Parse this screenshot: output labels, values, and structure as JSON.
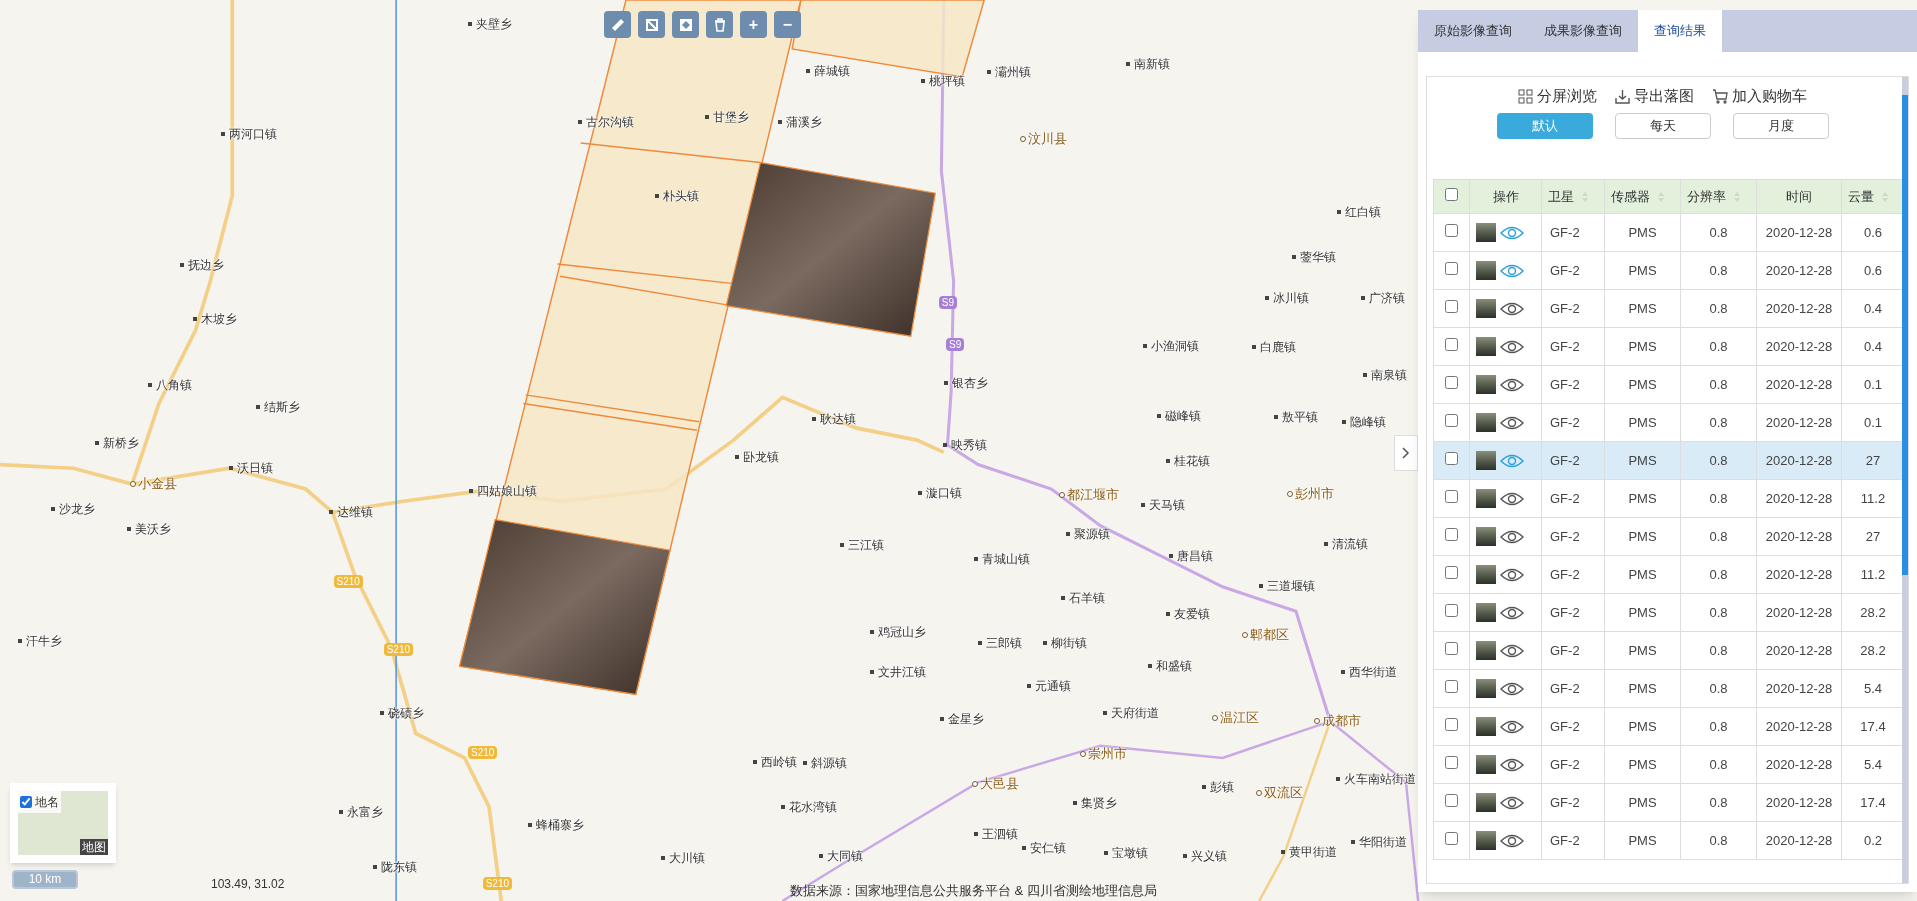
{
  "map_toolbar": [
    {
      "kind": "ruler"
    },
    {
      "kind": "polygon"
    },
    {
      "kind": "frame"
    },
    {
      "kind": "trash"
    },
    {
      "kind": "text",
      "label": "+"
    },
    {
      "kind": "text",
      "label": "−"
    }
  ],
  "map": {
    "places": [
      {
        "name": "夹壁乡",
        "kind": "town"
      },
      {
        "name": "两河口镇",
        "kind": "town"
      },
      {
        "name": "抚边乡",
        "kind": "town"
      },
      {
        "name": "木坡乡",
        "kind": "town"
      },
      {
        "name": "八角镇",
        "kind": "town"
      },
      {
        "name": "结斯乡",
        "kind": "town"
      },
      {
        "name": "新桥乡",
        "kind": "town"
      },
      {
        "name": "沃日镇",
        "kind": "town"
      },
      {
        "name": "小金县",
        "kind": "county"
      },
      {
        "name": "沙龙乡",
        "kind": "town"
      },
      {
        "name": "美沃乡",
        "kind": "town"
      },
      {
        "name": "达维镇",
        "kind": "town"
      },
      {
        "name": "汗牛乡",
        "kind": "town"
      },
      {
        "name": "四姑娘山镇",
        "kind": "town"
      },
      {
        "name": "硗碛乡",
        "kind": "town"
      },
      {
        "name": "永富乡",
        "kind": "town"
      },
      {
        "name": "陇东镇",
        "kind": "town"
      },
      {
        "name": "蜂桶寨乡",
        "kind": "town"
      },
      {
        "name": "大川镇",
        "kind": "town"
      },
      {
        "name": "古尔沟镇",
        "kind": "town"
      },
      {
        "name": "甘堡乡",
        "kind": "town"
      },
      {
        "name": "朴头镇",
        "kind": "town"
      },
      {
        "name": "蒲溪乡",
        "kind": "town"
      },
      {
        "name": "薛城镇",
        "kind": "town"
      },
      {
        "name": "桃坪镇",
        "kind": "town"
      },
      {
        "name": "灞州镇",
        "kind": "town"
      },
      {
        "name": "南新镇",
        "kind": "town"
      },
      {
        "name": "汶川县",
        "kind": "county"
      },
      {
        "name": "红白镇",
        "kind": "town"
      },
      {
        "name": "蓥华镇",
        "kind": "town"
      },
      {
        "name": "冰川镇",
        "kind": "town"
      },
      {
        "name": "广济镇",
        "kind": "town"
      },
      {
        "name": "小渔洞镇",
        "kind": "town"
      },
      {
        "name": "白鹿镇",
        "kind": "town"
      },
      {
        "name": "南泉镇",
        "kind": "town"
      },
      {
        "name": "银杏乡",
        "kind": "town"
      },
      {
        "name": "耿达镇",
        "kind": "town"
      },
      {
        "name": "磁峰镇",
        "kind": "town"
      },
      {
        "name": "敖平镇",
        "kind": "town"
      },
      {
        "name": "隐峰镇",
        "kind": "town"
      },
      {
        "name": "卧龙镇",
        "kind": "town"
      },
      {
        "name": "映秀镇",
        "kind": "town"
      },
      {
        "name": "桂花镇",
        "kind": "town"
      },
      {
        "name": "漩口镇",
        "kind": "town"
      },
      {
        "name": "都江堰市",
        "kind": "county"
      },
      {
        "name": "天马镇",
        "kind": "town"
      },
      {
        "name": "彭州市",
        "kind": "county"
      },
      {
        "name": "聚源镇",
        "kind": "town"
      },
      {
        "name": "三江镇",
        "kind": "town"
      },
      {
        "name": "青城山镇",
        "kind": "town"
      },
      {
        "name": "唐昌镇",
        "kind": "town"
      },
      {
        "name": "清流镇",
        "kind": "town"
      },
      {
        "name": "石羊镇",
        "kind": "town"
      },
      {
        "name": "三道堰镇",
        "kind": "town"
      },
      {
        "name": "友爱镇",
        "kind": "town"
      },
      {
        "name": "鸡冠山乡",
        "kind": "town"
      },
      {
        "name": "郫都区",
        "kind": "county"
      },
      {
        "name": "三郎镇",
        "kind": "town"
      },
      {
        "name": "柳街镇",
        "kind": "town"
      },
      {
        "name": "和盛镇",
        "kind": "town"
      },
      {
        "name": "文井江镇",
        "kind": "town"
      },
      {
        "name": "元通镇",
        "kind": "town"
      },
      {
        "name": "西华街道",
        "kind": "town"
      },
      {
        "name": "金星乡",
        "kind": "town"
      },
      {
        "name": "天府街道",
        "kind": "town"
      },
      {
        "name": "温江区",
        "kind": "county"
      },
      {
        "name": "成都市",
        "kind": "county"
      },
      {
        "name": "西岭镇",
        "kind": "town"
      },
      {
        "name": "斜源镇",
        "kind": "town"
      },
      {
        "name": "崇州市",
        "kind": "county"
      },
      {
        "name": "大邑县",
        "kind": "county"
      },
      {
        "name": "集贤乡",
        "kind": "town"
      },
      {
        "name": "彭镇",
        "kind": "town"
      },
      {
        "name": "双流区",
        "kind": "county"
      },
      {
        "name": "火车南站街道",
        "kind": "town"
      },
      {
        "name": "花水湾镇",
        "kind": "town"
      },
      {
        "name": "王泗镇",
        "kind": "town"
      },
      {
        "name": "安仁镇",
        "kind": "town"
      },
      {
        "name": "宝墩镇",
        "kind": "town"
      },
      {
        "name": "兴义镇",
        "kind": "town"
      },
      {
        "name": "黄甲街道",
        "kind": "town"
      },
      {
        "name": "华阳街道",
        "kind": "town"
      },
      {
        "name": "大同镇",
        "kind": "town"
      }
    ],
    "road_labels": [
      {
        "label": "S9",
        "kind": "expressway"
      },
      {
        "label": "S9",
        "kind": "expressway"
      },
      {
        "label": "S210",
        "kind": "provincial"
      },
      {
        "label": "S210",
        "kind": "provincial"
      },
      {
        "label": "S210",
        "kind": "provincial"
      },
      {
        "label": "S210",
        "kind": "provincial"
      }
    ]
  },
  "layer_switcher": {
    "label": "地名",
    "checked": true,
    "thumbnail_label": "地图"
  },
  "scale": "10 km",
  "coordinates": "103.49, 31.02",
  "attribution": "数据来源：国家地理信息公共服务平台 & 四川省测绘地理信息局",
  "panel": {
    "tabs": [
      {
        "label": "原始影像查询",
        "selected": false
      },
      {
        "label": "成果影像查询",
        "selected": false
      },
      {
        "label": "查询结果",
        "selected": true
      }
    ],
    "actions": [
      {
        "kind": "grid",
        "label": "分屏浏览"
      },
      {
        "kind": "download",
        "label": "导出落图"
      },
      {
        "kind": "cart",
        "label": "加入购物车"
      }
    ],
    "period_buttons": [
      {
        "label": "默认",
        "selected": true
      },
      {
        "label": "每天",
        "selected": false
      },
      {
        "label": "月度",
        "selected": false
      }
    ],
    "table": {
      "header_checked": false,
      "action_column_label": "操作",
      "columns": [
        {
          "label": "卫星",
          "sortable": true
        },
        {
          "label": "传感器",
          "sortable": true
        },
        {
          "label": "分辨率",
          "sortable": true
        },
        {
          "label": "时间",
          "sortable": false
        },
        {
          "label": "云量",
          "sortable": true
        }
      ],
      "rows": [
        {
          "checked": false,
          "previewed": true,
          "selected": false,
          "cells": [
            "GF-2",
            "PMS",
            "0.8",
            "2020-12-28",
            "0.6"
          ]
        },
        {
          "checked": false,
          "previewed": true,
          "selected": false,
          "cells": [
            "GF-2",
            "PMS",
            "0.8",
            "2020-12-28",
            "0.6"
          ]
        },
        {
          "checked": false,
          "previewed": false,
          "selected": false,
          "cells": [
            "GF-2",
            "PMS",
            "0.8",
            "2020-12-28",
            "0.4"
          ]
        },
        {
          "checked": false,
          "previewed": false,
          "selected": false,
          "cells": [
            "GF-2",
            "PMS",
            "0.8",
            "2020-12-28",
            "0.4"
          ]
        },
        {
          "checked": false,
          "previewed": false,
          "selected": false,
          "cells": [
            "GF-2",
            "PMS",
            "0.8",
            "2020-12-28",
            "0.1"
          ]
        },
        {
          "checked": false,
          "previewed": false,
          "selected": false,
          "cells": [
            "GF-2",
            "PMS",
            "0.8",
            "2020-12-28",
            "0.1"
          ]
        },
        {
          "checked": false,
          "previewed": true,
          "selected": true,
          "cells": [
            "GF-2",
            "PMS",
            "0.8",
            "2020-12-28",
            "27"
          ]
        },
        {
          "checked": false,
          "previewed": false,
          "selected": false,
          "cells": [
            "GF-2",
            "PMS",
            "0.8",
            "2020-12-28",
            "11.2"
          ]
        },
        {
          "checked": false,
          "previewed": false,
          "selected": false,
          "cells": [
            "GF-2",
            "PMS",
            "0.8",
            "2020-12-28",
            "27"
          ]
        },
        {
          "checked": false,
          "previewed": false,
          "selected": false,
          "cells": [
            "GF-2",
            "PMS",
            "0.8",
            "2020-12-28",
            "11.2"
          ]
        },
        {
          "checked": false,
          "previewed": false,
          "selected": false,
          "cells": [
            "GF-2",
            "PMS",
            "0.8",
            "2020-12-28",
            "28.2"
          ]
        },
        {
          "checked": false,
          "previewed": false,
          "selected": false,
          "cells": [
            "GF-2",
            "PMS",
            "0.8",
            "2020-12-28",
            "28.2"
          ]
        },
        {
          "checked": false,
          "previewed": false,
          "selected": false,
          "cells": [
            "GF-2",
            "PMS",
            "0.8",
            "2020-12-28",
            "5.4"
          ]
        },
        {
          "checked": false,
          "previewed": false,
          "selected": false,
          "cells": [
            "GF-2",
            "PMS",
            "0.8",
            "2020-12-28",
            "17.4"
          ]
        },
        {
          "checked": false,
          "previewed": false,
          "selected": false,
          "cells": [
            "GF-2",
            "PMS",
            "0.8",
            "2020-12-28",
            "5.4"
          ]
        },
        {
          "checked": false,
          "previewed": false,
          "selected": false,
          "cells": [
            "GF-2",
            "PMS",
            "0.8",
            "2020-12-28",
            "17.4"
          ]
        },
        {
          "checked": false,
          "previewed": false,
          "selected": false,
          "cells": [
            "GF-2",
            "PMS",
            "0.8",
            "2020-12-28",
            "0.2"
          ]
        }
      ]
    }
  }
}
